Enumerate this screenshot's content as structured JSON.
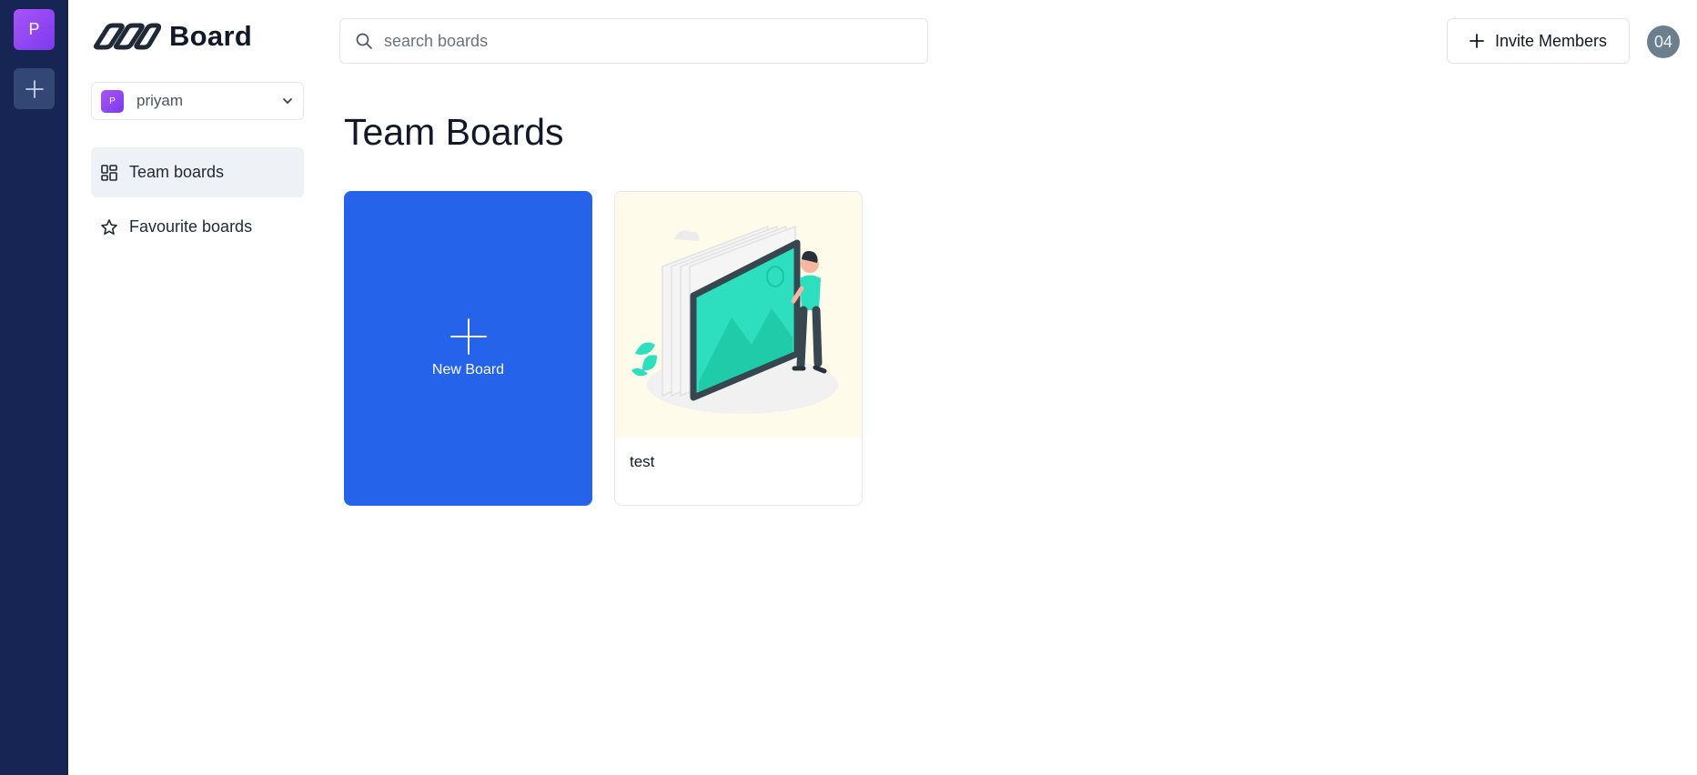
{
  "rail": {
    "org_initial": "P",
    "add_org_icon": "plus-icon"
  },
  "sidebar": {
    "logo_text": "Board",
    "org_switcher": {
      "initial": "P",
      "name": "priyam"
    },
    "nav": [
      {
        "label": "Team boards",
        "icon": "dashboard-grid-icon",
        "active": true
      },
      {
        "label": "Favourite boards",
        "icon": "star-icon",
        "active": false
      }
    ]
  },
  "header": {
    "search_placeholder": "search boards",
    "invite_label": "Invite Members",
    "avatar_text": "04"
  },
  "main": {
    "title": "Team Boards",
    "new_board_label": "New Board",
    "boards": [
      {
        "title": "test"
      }
    ]
  },
  "colors": {
    "rail_bg": "#172554",
    "accent_blue": "#2563eb",
    "org_purple": "#8b5cf6",
    "thumb_bg": "#fefbea",
    "illustration_teal": "#2ddfbf"
  }
}
